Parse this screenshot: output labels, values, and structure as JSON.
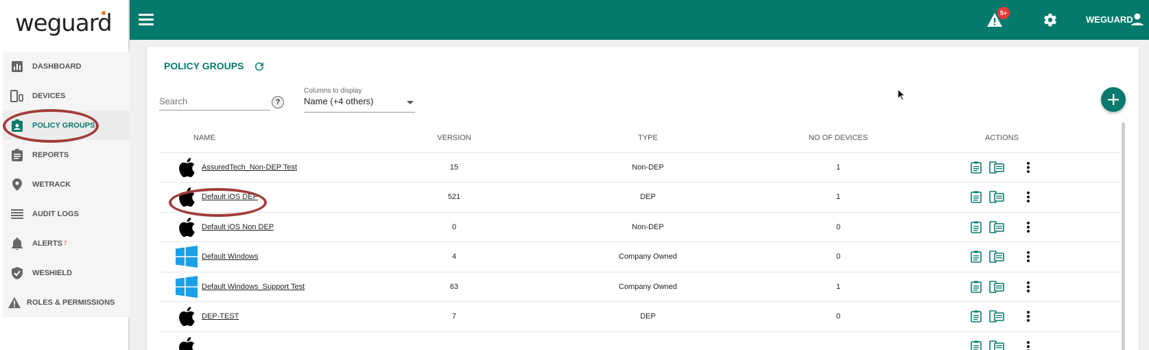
{
  "brand": {
    "logo_text": "weguard",
    "accent": "#037a6b"
  },
  "sidebar": {
    "items": [
      {
        "label": "DASHBOARD",
        "icon": "bar-chart-icon"
      },
      {
        "label": "DEVICES",
        "icon": "devices-icon"
      },
      {
        "label": "POLICY GROUPS",
        "icon": "clipboard-user-icon",
        "active": true
      },
      {
        "label": "REPORTS",
        "icon": "clipboard-icon"
      },
      {
        "label": "WETRACK",
        "icon": "location-pin-icon"
      },
      {
        "label": "AUDIT LOGS",
        "icon": "list-icon"
      },
      {
        "label": "ALERTS",
        "icon": "bell-icon",
        "count": "7"
      },
      {
        "label": "WESHIELD",
        "icon": "shield-icon"
      },
      {
        "label": "ROLES & PERMISSIONS",
        "icon": "warning-icon"
      }
    ]
  },
  "topbar": {
    "alert_badge": "5+",
    "user_label": "WEGUARD"
  },
  "main": {
    "title": "POLICY GROUPS",
    "search_placeholder": "Search",
    "help_label": "?",
    "columns_label": "Columns to display",
    "columns_value": "Name (+4 others)",
    "table": {
      "headers": {
        "name": "NAME",
        "version": "VERSION",
        "type": "TYPE",
        "devices": "NO OF DEVICES",
        "actions": "ACTIONS"
      },
      "rows": [
        {
          "os": "apple",
          "name": "AssuredTech_Non-DEP Test",
          "version": "15",
          "type": "Non-DEP",
          "devices": "1"
        },
        {
          "os": "apple",
          "name": "Default iOS DEP",
          "version": "521",
          "type": "DEP",
          "devices": "1"
        },
        {
          "os": "apple",
          "name": "Default iOS Non DEP",
          "version": "0",
          "type": "Non-DEP",
          "devices": "0"
        },
        {
          "os": "windows",
          "name": "Default Windows",
          "version": "4",
          "type": "Company Owned",
          "devices": "0"
        },
        {
          "os": "windows",
          "name": "Default Windows_Support Test",
          "version": "63",
          "type": "Company Owned",
          "devices": "1"
        },
        {
          "os": "apple",
          "name": "DEP-TEST",
          "version": "7",
          "type": "DEP",
          "devices": "0"
        },
        {
          "os": "apple",
          "name": "",
          "version": "",
          "type": "",
          "devices": ""
        }
      ]
    }
  }
}
